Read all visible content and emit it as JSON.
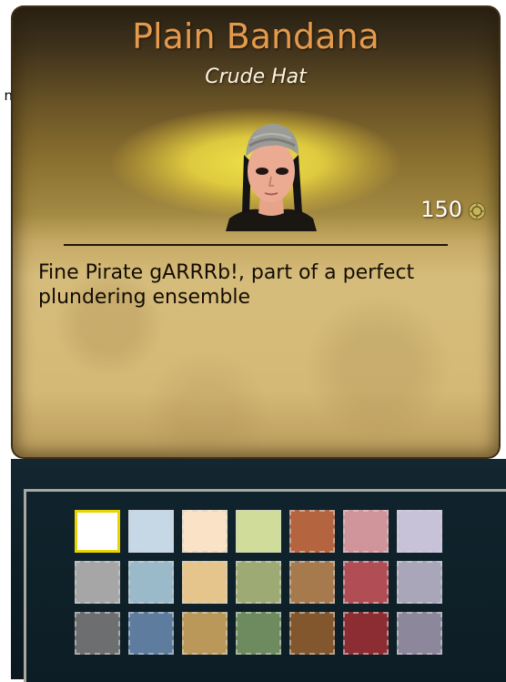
{
  "edge_label": "n",
  "item": {
    "name": "Plain Bandana",
    "type": "Crude Hat",
    "price": "150",
    "price_icon": "gold-coin-icon",
    "description": "Fine Pirate gARRRb!, part of a perfect plundering ensemble"
  },
  "palette": {
    "selected_index": 0,
    "swatches": [
      "#ffffff",
      "#c6d7e5",
      "#f9e2c6",
      "#cfdc9a",
      "#b4643f",
      "#d0959b",
      "#c7c2d8",
      "#a7a6a6",
      "#9bbac9",
      "#e6c58d",
      "#9daa74",
      "#a77a4e",
      "#b14e55",
      "#a8a6b8",
      "#6c6e6f",
      "#5e7c9e",
      "#b9985a",
      "#6e8a5f",
      "#83572e",
      "#8c2d33",
      "#8c879a"
    ]
  }
}
